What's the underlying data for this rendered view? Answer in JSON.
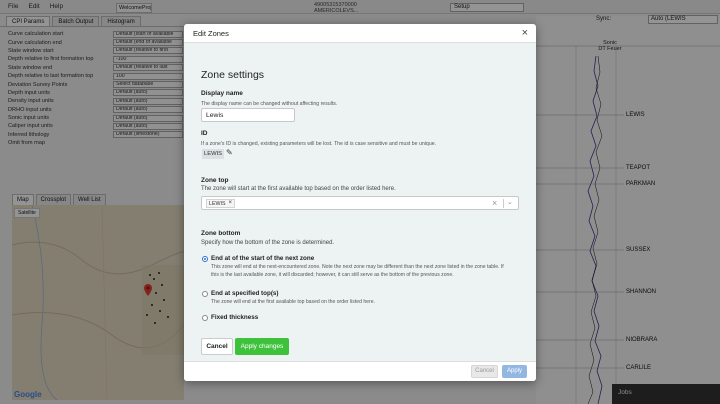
{
  "app": {
    "menu": [
      "File",
      "Edit",
      "Help"
    ],
    "doc_tab": "WelcomeProject.cpt",
    "top_id_line1": "49005315370000",
    "top_id_line2": "AMERICOLEVS...",
    "top_select": "Setup",
    "left_tabs": [
      "CPI Params",
      "Batch Output",
      "Histogram"
    ],
    "params": [
      {
        "label": "Curve calculation start",
        "value": "Default (start of available"
      },
      {
        "label": "Curve calculation end",
        "value": "Default (end of available"
      },
      {
        "label": "State window start",
        "value": "Default (relative to first"
      },
      {
        "label": "Depth relative to first formation top",
        "value": "-100"
      },
      {
        "label": "State window end",
        "value": "Default (relative to last"
      },
      {
        "label": "Depth relative to last formation top",
        "value": "100"
      },
      {
        "label": "Deviation Survey Points",
        "value": "Select database"
      },
      {
        "label": "Depth input units",
        "value": "Default (auto)"
      },
      {
        "label": "Density input units",
        "value": "Default (auto)"
      },
      {
        "label": "DRHO input units",
        "value": "Default (auto)"
      },
      {
        "label": "Sonic input units",
        "value": "Default (auto)"
      },
      {
        "label": "Caliper input units",
        "value": "Default (auto)"
      },
      {
        "label": "Inferred lithology",
        "value": "Default (limestone)"
      },
      {
        "label": "Omit from map",
        "value": ""
      }
    ],
    "map_tabs": [
      "Map",
      "Crossplot",
      "Well List"
    ],
    "map_type": "Satellite",
    "google": "Google",
    "sync_label": "Sync:",
    "sync_value": "Auto (LEWIS",
    "track_header_1": "Sonic",
    "track_header_2": "DT Feuer",
    "formations": [
      "LEWIS",
      "TEAPOT",
      "PARKMAN",
      "SUSSEX",
      "SHANNON",
      "NIOBRARA",
      "CARLILE"
    ],
    "jobs": "Jobs"
  },
  "modal": {
    "title": "Edit Zones",
    "close_glyph": "×",
    "section_title": "Zone settings",
    "display_name": {
      "label": "Display name",
      "help": "The display name can be changed without affecting results.",
      "value": "Lewis"
    },
    "id": {
      "label": "ID",
      "help_line1": "If a zone's ID is changed, existing parameters will be lost. The id is case sensitive and must be unique.",
      "value": "LEWIS",
      "edit_icon": "✎"
    },
    "zone_top": {
      "label": "Zone top",
      "help": "The zone will start at the first available top based on the order listed here.",
      "tag": "LEWIS",
      "tag_remove": "×",
      "clear": "×",
      "chevron": "⌄"
    },
    "zone_bottom": {
      "label": "Zone bottom",
      "help": "Specify how the bottom of the zone is determined.",
      "options": [
        {
          "label": "End at of the start of the next zone",
          "help_line1": "This zone will end at the next-encountered zone. Note the next zone may be different than the next zone listed in the zone table. If",
          "help_line2": "this is the last available zone, it will discarded; however, it can still serve as the bottom of the previous zone.",
          "checked": true
        },
        {
          "label": "End at specified top(s)",
          "help_line1": "The zone will end at the first available top based on the order listed here.",
          "help_line2": "",
          "checked": false
        },
        {
          "label": "Fixed thickness",
          "help_line1": "",
          "help_line2": "",
          "checked": false
        }
      ]
    },
    "buttons": {
      "cancel": "Cancel",
      "apply": "Apply changes"
    },
    "footer": {
      "cancel": "Cancel",
      "apply": "Apply"
    }
  }
}
